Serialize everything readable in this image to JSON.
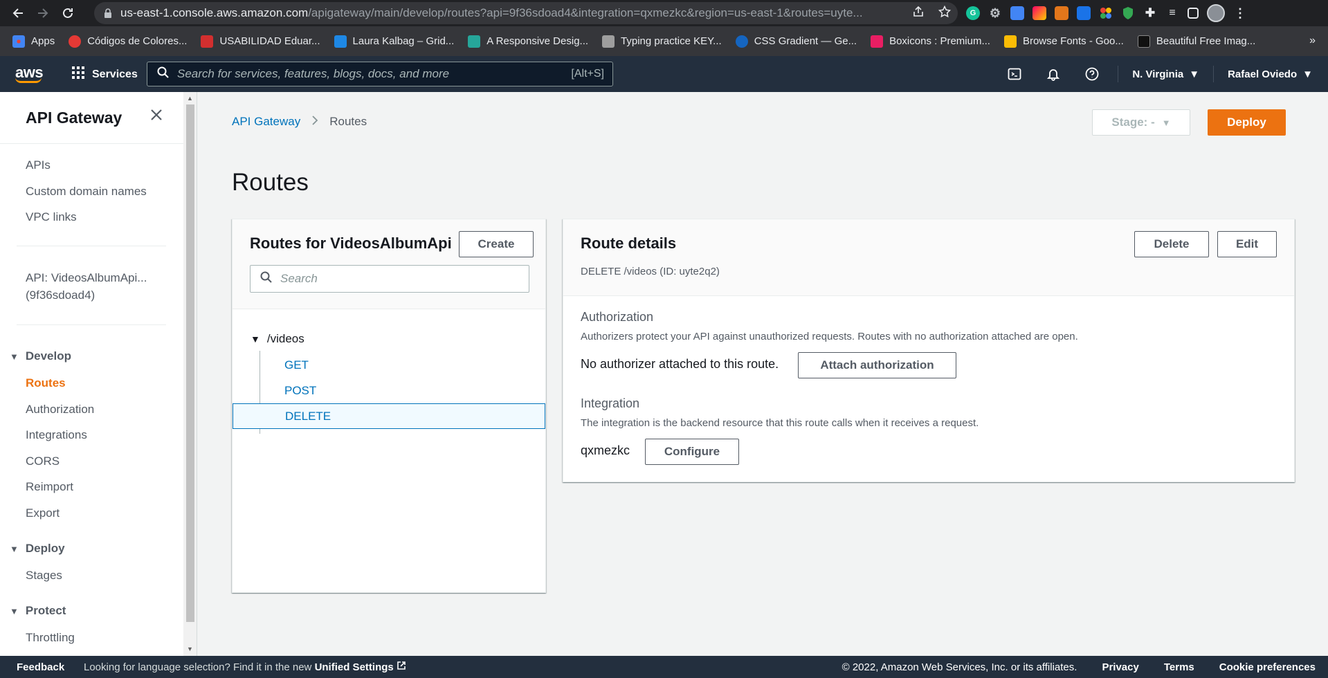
{
  "browser": {
    "url_host": "us-east-1.console.aws.amazon.com",
    "url_path": "/apigateway/main/develop/routes?api=9f36sdoad4&integration=qxmezkc&region=us-east-1&routes=uyte...",
    "bookmarks": [
      {
        "label": "Apps",
        "color": "#4285f4"
      },
      {
        "label": "Códigos de Colores...",
        "color": "#e53935"
      },
      {
        "label": "USABILIDAD Eduar...",
        "color": "#d32f2f"
      },
      {
        "label": "Laura Kalbag – Grid...",
        "color": "#1e88e5"
      },
      {
        "label": "A Responsive Desig...",
        "color": "#26a69a"
      },
      {
        "label": "Typing practice KEY...",
        "color": "#9e9e9e"
      },
      {
        "label": "CSS Gradient — Ge...",
        "color": "#1565c0"
      },
      {
        "label": "Boxicons : Premium...",
        "color": "#e91e63"
      },
      {
        "label": "Browse Fonts - Goo...",
        "color": "#fbbc05"
      },
      {
        "label": "Beautiful Free Imag...",
        "color": "#111111"
      }
    ],
    "more_bookmarks": "»"
  },
  "aws_header": {
    "logo": "aws",
    "services_label": "Services",
    "search_placeholder": "Search for services, features, blogs, docs, and more",
    "search_shortcut": "[Alt+S]",
    "region": "N. Virginia",
    "user": "Rafael Oviedo"
  },
  "sidebar": {
    "title": "API Gateway",
    "top_links": [
      "APIs",
      "Custom domain names",
      "VPC links"
    ],
    "api_line1": "API: VideosAlbumApi...",
    "api_line2": "(9f36sdoad4)",
    "sections": [
      {
        "label": "Develop",
        "items": [
          "Routes",
          "Authorization",
          "Integrations",
          "CORS",
          "Reimport",
          "Export"
        ]
      },
      {
        "label": "Deploy",
        "items": [
          "Stages"
        ]
      },
      {
        "label": "Protect",
        "items": [
          "Throttling"
        ]
      }
    ],
    "active_item": "Routes"
  },
  "breadcrumb": {
    "root": "API Gateway",
    "current": "Routes"
  },
  "stage_select": {
    "label": "Stage: -"
  },
  "deploy_button": "Deploy",
  "page_title": "Routes",
  "routes_panel": {
    "title": "Routes for VideosAlbumApi",
    "create_button": "Create",
    "search_placeholder": "Search",
    "tree": {
      "path": "/videos",
      "methods": [
        "GET",
        "POST",
        "DELETE"
      ],
      "selected": "DELETE"
    }
  },
  "route_details": {
    "title": "Route details",
    "subtitle": "DELETE /videos (ID: uyte2q2)",
    "delete_button": "Delete",
    "edit_button": "Edit",
    "authorization": {
      "label": "Authorization",
      "description": "Authorizers protect your API against unauthorized requests. Routes with no authorization attached are open.",
      "value": "No authorizer attached to this route.",
      "button": "Attach authorization"
    },
    "integration": {
      "label": "Integration",
      "description": "The integration is the backend resource that this route calls when it receives a request.",
      "value": "qxmezkc",
      "button": "Configure"
    }
  },
  "footer": {
    "feedback": "Feedback",
    "lang_text": "Looking for language selection? Find it in the new",
    "lang_link": "Unified Settings",
    "copyright": "© 2022, Amazon Web Services, Inc. or its affiliates.",
    "links": [
      "Privacy",
      "Terms",
      "Cookie preferences"
    ]
  },
  "colors": {
    "aws_dark": "#232f3e",
    "accent_orange": "#ec7211",
    "link_blue": "#0073bb"
  }
}
